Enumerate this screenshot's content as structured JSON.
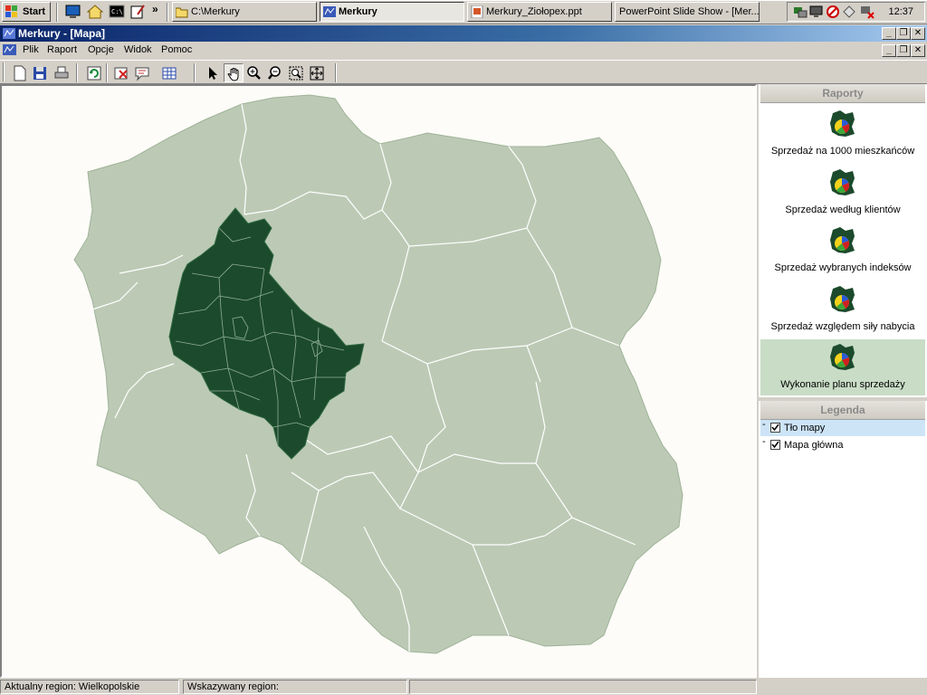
{
  "taskbar": {
    "start_label": "Start",
    "tasks": [
      {
        "label": "C:\\Merkury",
        "pressed": false
      },
      {
        "label": "Merkury",
        "pressed": true
      },
      {
        "label": "Merkury_Ziołopex.ppt",
        "pressed": false
      },
      {
        "label": "PowerPoint Slide Show - [Mer...",
        "pressed": false
      }
    ],
    "quicklaunch_more": "»",
    "clock": "12:37"
  },
  "window": {
    "title": "Merkury - [Mapa]"
  },
  "menu": {
    "items": [
      "Plik",
      "Raport",
      "Opcje",
      "Widok",
      "Pomoc"
    ]
  },
  "toolbar": {
    "tools": [
      "new-document",
      "save",
      "print",
      "refresh",
      "delete-region",
      "chat-label",
      "grid-table",
      "pointer",
      "pan-hand",
      "zoom-in",
      "zoom-out",
      "zoom-window",
      "full-extent"
    ],
    "active_tool": "pan-hand"
  },
  "map": {
    "selected_region": "Wielkopolskie",
    "colors": {
      "background": "#fdfcf8",
      "land": "#bccab5",
      "selected": "#1c4a2c",
      "borders": "#ffffff"
    }
  },
  "reports": {
    "header": "Raporty",
    "items": [
      {
        "label": "Sprzedaż na 1000 mieszkańców",
        "selected": false
      },
      {
        "label": "Sprzedaż według klientów",
        "selected": false
      },
      {
        "label": "Sprzedaż wybranych indeksów",
        "selected": false
      },
      {
        "label": "Sprzedaż względem siły nabycia",
        "selected": false
      },
      {
        "label": "Wykonanie planu sprzedaży",
        "selected": true
      }
    ]
  },
  "legend": {
    "header": "Legenda",
    "items": [
      {
        "label": "Tło mapy",
        "checked": true,
        "selected": true
      },
      {
        "label": "Mapa główna",
        "checked": true,
        "selected": false
      }
    ]
  },
  "status": {
    "current_region": "Aktualny region: Wielkopolskie",
    "pointed_region": "Wskazywany region:"
  }
}
